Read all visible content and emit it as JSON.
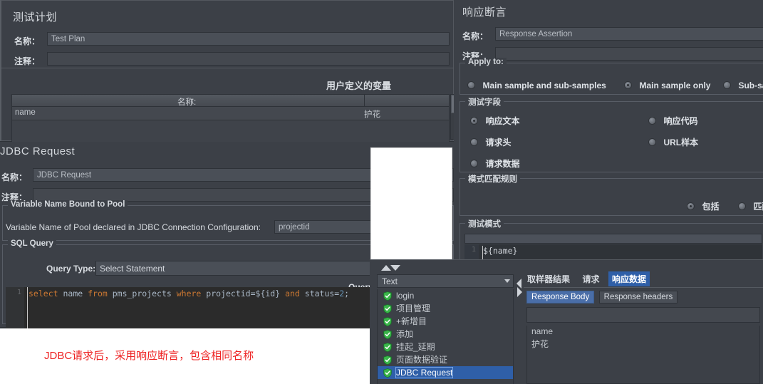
{
  "test_plan": {
    "title": "测试计划",
    "name_label": "名称：",
    "name_value": "Test Plan",
    "comment_label": "注释：",
    "comment_value": "",
    "udv_title": "用户定义的变量",
    "table_headers": [
      "名称:",
      ""
    ],
    "rows": [
      [
        "name",
        "护花"
      ]
    ]
  },
  "jdbc": {
    "title": "JDBC Request",
    "name_label": "名称：",
    "name_value": "JDBC Request",
    "comment_label": "注释：",
    "comment_value": "",
    "pool_group_title": "Variable Name Bound to Pool",
    "pool_label": "Variable Name of Pool declared in JDBC Connection Configuration:",
    "pool_value": "projectid",
    "sql_group_title": "SQL Query",
    "query_type_label": "Query Type:",
    "query_type_value": "Select Statement",
    "query_label": "Query:",
    "query_line_number": "1",
    "query_tokens": [
      {
        "t": "select",
        "k": "kw"
      },
      {
        "t": " name ",
        "k": ""
      },
      {
        "t": "from",
        "k": "kw"
      },
      {
        "t": " pms_projects ",
        "k": ""
      },
      {
        "t": "where",
        "k": "kw"
      },
      {
        "t": " projectid=${id} ",
        "k": ""
      },
      {
        "t": "and",
        "k": "kw"
      },
      {
        "t": " status=",
        "k": ""
      },
      {
        "t": "2",
        "k": "num"
      },
      {
        "t": ";",
        "k": ""
      }
    ]
  },
  "note": {
    "text": "JDBC请求后，采用响应断言，包含相同名称",
    "color": "#ee2222"
  },
  "assertion": {
    "title": "响应断言",
    "name_label": "名称：",
    "name_value": "Response Assertion",
    "comment_label": "注释：",
    "comment_value": "",
    "apply_to": {
      "title": "Apply to:",
      "options": [
        {
          "label": "Main sample and sub-samples",
          "selected": false
        },
        {
          "label": "Main sample only",
          "selected": true
        },
        {
          "label": "Sub-samples only",
          "selected": false
        }
      ]
    },
    "test_field": {
      "title": "测试字段",
      "options": [
        {
          "label": "响应文本",
          "selected": true
        },
        {
          "label": "响应代码",
          "selected": false
        },
        {
          "label": "请求头",
          "selected": false
        },
        {
          "label": "URL样本",
          "selected": false
        },
        {
          "label": "请求数据",
          "selected": false
        }
      ]
    },
    "pattern_rules": {
      "title": "模式匹配规则",
      "options": [
        {
          "label": "包括",
          "selected": true
        },
        {
          "label": "匹配",
          "selected": false
        }
      ]
    },
    "test_patterns": {
      "title": "测试模式",
      "line_number": "1",
      "value": "${name}"
    }
  },
  "results": {
    "renderer_combo": {
      "value": "Text",
      "icon": "chevron-down-icon"
    },
    "tree_items": [
      {
        "label": "login",
        "status": "success",
        "selected": false
      },
      {
        "label": "项目管理",
        "status": "success",
        "selected": false
      },
      {
        "label": "+新增目",
        "status": "success",
        "selected": false
      },
      {
        "label": "添加",
        "status": "success",
        "selected": false
      },
      {
        "label": "挂起_延期",
        "status": "success",
        "selected": false
      },
      {
        "label": "页面数据验证",
        "status": "success",
        "selected": false
      },
      {
        "label": "JDBC Request",
        "status": "success",
        "selected": true
      }
    ],
    "tabs": [
      {
        "label": "取样器结果",
        "active": false
      },
      {
        "label": "请求",
        "active": false
      },
      {
        "label": "响应数据",
        "active": true
      }
    ],
    "subtabs": [
      {
        "label": "Response Body",
        "active": true
      },
      {
        "label": "Response headers",
        "active": false
      }
    ],
    "search_value": "",
    "body_lines": [
      "name",
      "护花"
    ]
  },
  "colors": {
    "panel_bg": "#3c4047",
    "field_bg": "#4a4f57",
    "accent_blue": "#2f5fa8",
    "text": "#c8ccd1",
    "code_bg": "#2b2b2b",
    "keyword": "#cc7832",
    "shield_green": "#3ab54a"
  }
}
